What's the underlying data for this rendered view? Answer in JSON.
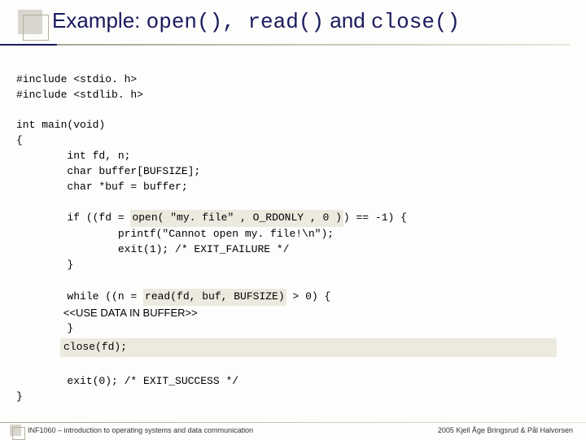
{
  "title": {
    "prefix": "Example: ",
    "f1": "open()",
    "sep1": ", ",
    "f2": "read()",
    "mid": " and ",
    "f3": "close()"
  },
  "code": {
    "inc1": "#include <stdio. h>",
    "inc2": "#include <stdlib. h>",
    "main": "int main(void)",
    "ob": "{",
    "decl1": "        int fd, n;",
    "decl2": "        char buffer[BUFSIZE];",
    "decl3": "        char *buf = buffer;",
    "if1a": "        if ((fd = ",
    "if1b": "open( \"my. file\" , O_RDONLY , 0 )",
    "if1c": ") == -1) {",
    "if2": "                printf(\"Cannot open my. file!\\n\");",
    "if3": "                exit(1); /* EXIT_FAILURE */",
    "if4": "        }",
    "wh1a": "        while ((n = ",
    "wh1b": "read(fd, buf, BUFSIZE)",
    "wh1c": " > 0) {",
    "wh2": "                <<USE DATA IN BUFFER>>",
    "wh3": "        }",
    "close": "close(fd);",
    "exit": "        exit(0); /* EXIT_SUCCESS */",
    "cb": "}"
  },
  "footer": {
    "left": "INF1060 – introduction to operating systems and data communication",
    "right": "2005 Kjell Åge Bringsrud & Pål Halvorsen"
  }
}
